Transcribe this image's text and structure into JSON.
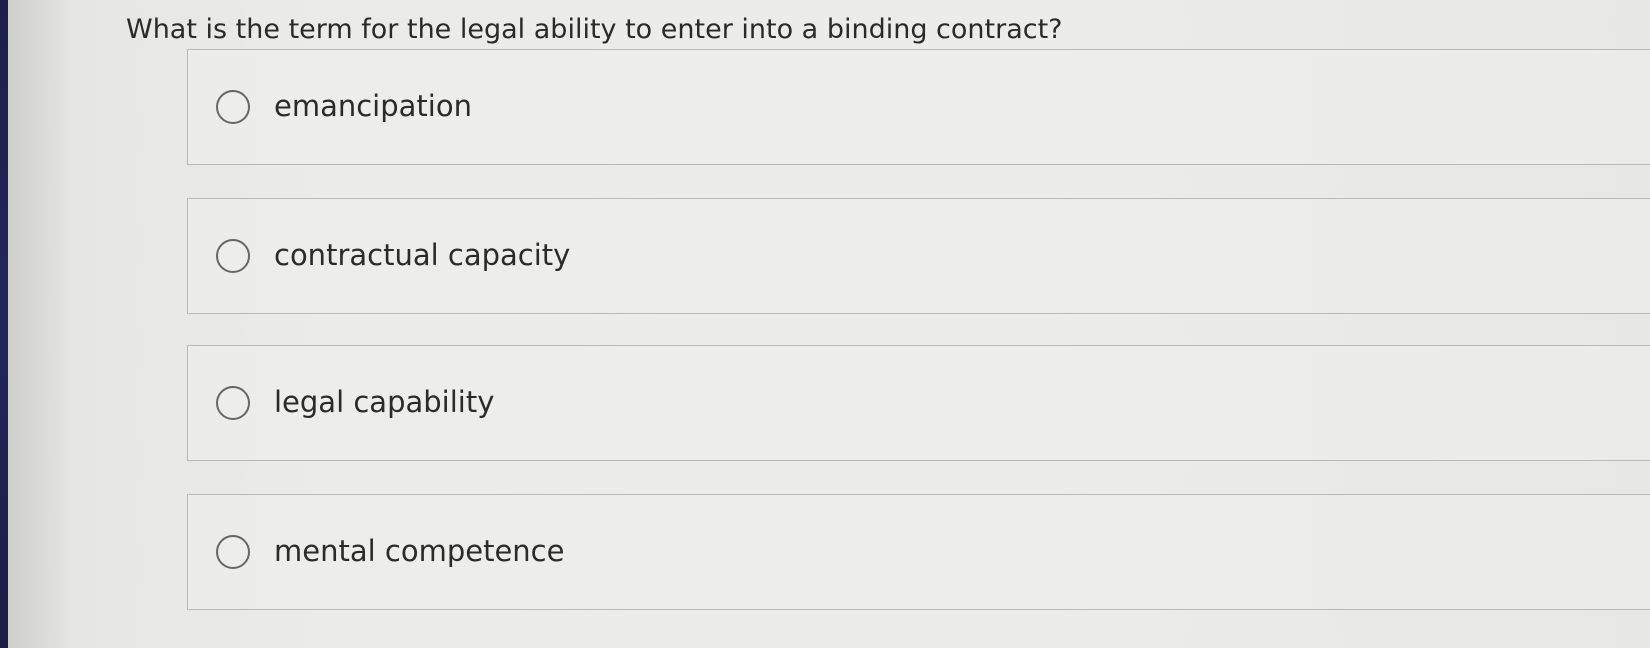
{
  "question": {
    "text": "What is the term for the legal ability to enter into a binding contract?"
  },
  "options": [
    {
      "label": "emancipation",
      "selected": false
    },
    {
      "label": "contractual capacity",
      "selected": false
    },
    {
      "label": "legal capability",
      "selected": false
    },
    {
      "label": "mental competence",
      "selected": false
    }
  ]
}
